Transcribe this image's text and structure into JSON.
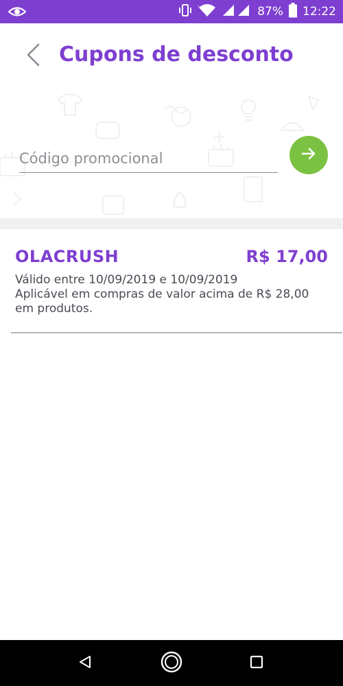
{
  "status_bar": {
    "battery_percent": "87%",
    "time": "12:22",
    "icons": [
      "eye-icon",
      "vibrate-icon",
      "wifi-icon",
      "signal-icon",
      "battery-icon"
    ]
  },
  "header": {
    "title": "Cupons de desconto",
    "back_icon": "chevron-left-icon"
  },
  "promo": {
    "placeholder": "Código promocional",
    "value": "",
    "submit_icon": "arrow-right-icon"
  },
  "coupons": [
    {
      "code": "OLACRUSH",
      "value": "R$ 17,00",
      "validity": "Válido entre 10/09/2019 e 10/09/2019",
      "condition": "Aplicável em compras de valor acima de R$ 28,00 em produtos."
    }
  ],
  "nav_bar": {
    "buttons": [
      "back-triangle-icon",
      "home-circle-icon",
      "recents-square-icon"
    ]
  },
  "colors": {
    "brand": "#7e3fd0",
    "accent_green": "#7cc242",
    "nav_bar": "#000000"
  }
}
